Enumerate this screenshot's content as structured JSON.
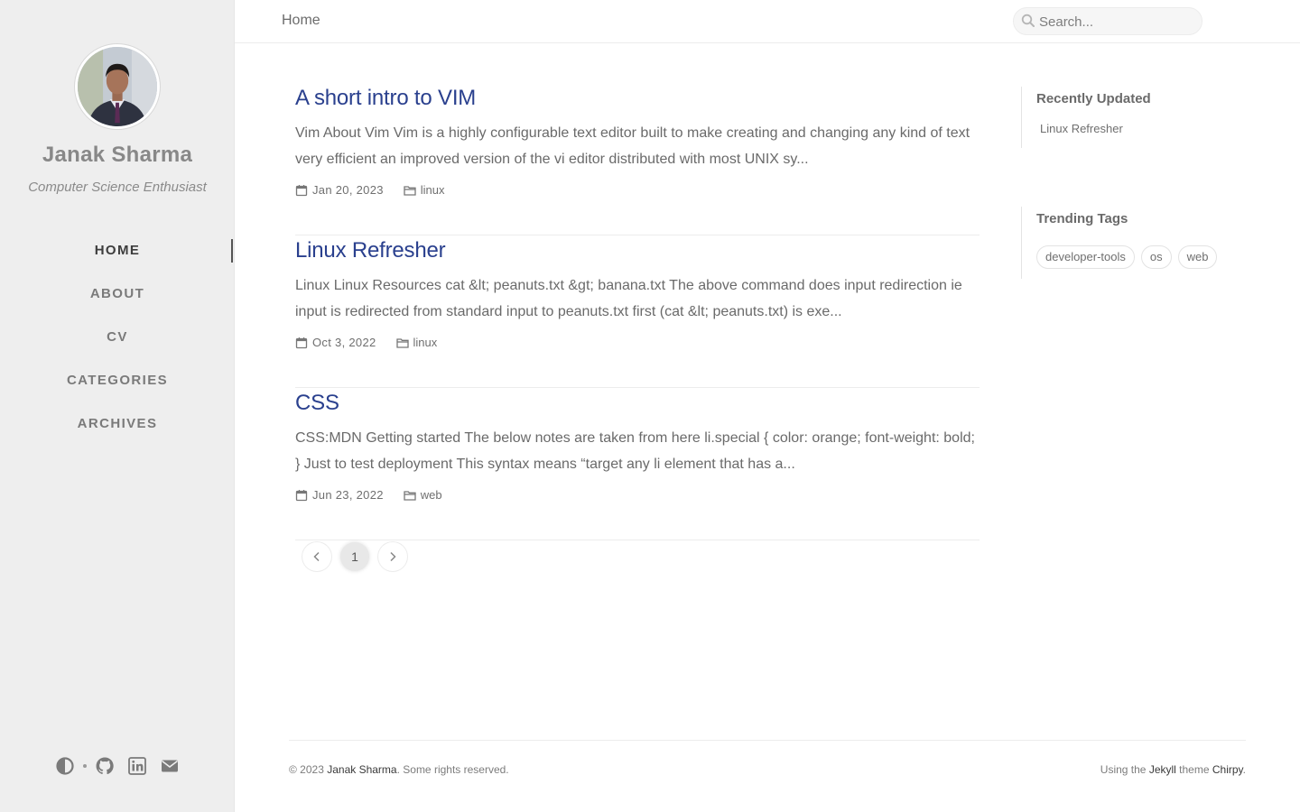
{
  "sidebar": {
    "author_name": "Janak Sharma",
    "tagline": "Computer Science Enthusiast",
    "nav": [
      {
        "label": "HOME",
        "active": true
      },
      {
        "label": "ABOUT",
        "active": false
      },
      {
        "label": "CV",
        "active": false
      },
      {
        "label": "CATEGORIES",
        "active": false
      },
      {
        "label": "ARCHIVES",
        "active": false
      }
    ],
    "bottom_icons": [
      "theme-toggle-icon",
      "github-icon",
      "linkedin-icon",
      "email-icon"
    ]
  },
  "topbar": {
    "breadcrumb": "Home",
    "search_placeholder": "Search..."
  },
  "posts": [
    {
      "title": "A short intro to VIM",
      "excerpt": "Vim About Vim Vim is a highly configurable text editor built to make creating and changing any kind of text very efficient an improved version of the vi editor distributed with most UNIX sy...",
      "date": "Jan 20, 2023",
      "category": "linux"
    },
    {
      "title": "Linux Refresher",
      "excerpt": "Linux Linux Resources cat &lt; peanuts.txt &gt; banana.txt The above command does input redirection ie input is redirected from standard input to peanuts.txt first (cat &lt; peanuts.txt) is exe...",
      "date": "Oct 3, 2022",
      "category": "linux"
    },
    {
      "title": "CSS",
      "excerpt": "CSS:MDN Getting started The below notes are taken from here li.special { color: orange; font-weight: bold; } Just to test deployment This syntax means “target any li element that has a...",
      "date": "Jun 23, 2022",
      "category": "web"
    }
  ],
  "pagination": {
    "current_page": "1"
  },
  "panel": {
    "recent_title": "Recently Updated",
    "recent_items": [
      "Linux Refresher"
    ],
    "tags_title": "Trending Tags",
    "tags": [
      "developer-tools",
      "os",
      "web"
    ]
  },
  "footer": {
    "copyright_prefix": "© 2023 ",
    "author_link": "Janak Sharma",
    "rights": ". Some rights reserved.",
    "using_prefix": "Using the ",
    "jekyll_link": "Jekyll",
    "theme_text": " theme ",
    "chirpy_link": "Chirpy",
    "suffix": "."
  },
  "colors": {
    "sidebar_bg": "#eeeeee",
    "post_title": "#2a408e",
    "text_muted": "#6a6a6a"
  }
}
